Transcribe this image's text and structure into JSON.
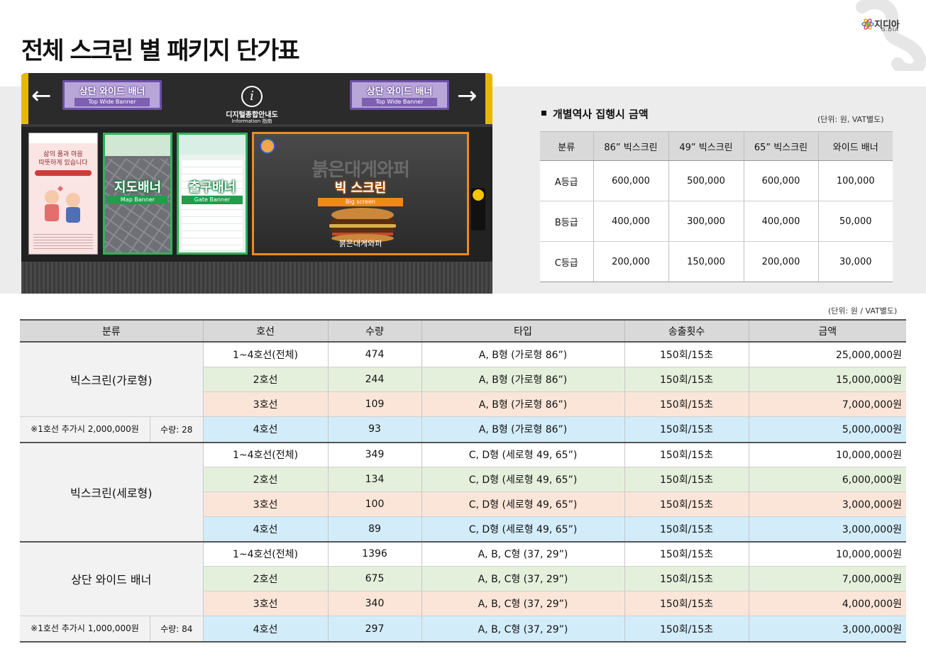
{
  "page": {
    "title": "전체 스크린 별 패키지 단가표",
    "logo": {
      "text": "지디아",
      "sub": "G.DIA"
    }
  },
  "kiosk": {
    "left_arrow": "←",
    "right_arrow": "→",
    "wide_banner_label": "상단 와이드 배너",
    "wide_banner_sub": "Top Wide Banner",
    "info_title": "디지털종합안내도",
    "info_sub": "Information 指南",
    "map_banner_label": "지도배너",
    "map_banner_sub": "Map Banner",
    "gate_banner_label": "출구배너",
    "gate_banner_sub": "Gate Banner",
    "big_headline": "붉은대게와퍼",
    "big_label": "빅 스크린",
    "big_sub": "Big screen",
    "big_footer": "붉은대게와퍼",
    "poster_text_1": "삶의 품과 마음",
    "poster_text_2": "따뜻하게 있습니다"
  },
  "small_table": {
    "title": "개별역사 집행시 금액",
    "unit": "(단위: 원, VAT별도)",
    "headers": [
      "분류",
      "86” 빅스크린",
      "49” 빅스크린",
      "65” 빅스크린",
      "와이드 배너"
    ],
    "rows": [
      [
        "A등급",
        "600,000",
        "500,000",
        "600,000",
        "100,000"
      ],
      [
        "B등급",
        "400,000",
        "300,000",
        "400,000",
        "50,000"
      ],
      [
        "C등급",
        "200,000",
        "150,000",
        "200,000",
        "30,000"
      ]
    ]
  },
  "main_table": {
    "unit": "(단위: 원 / VAT별도)",
    "headers": [
      "분류",
      "호선",
      "수량",
      "타입",
      "송출횟수",
      "금액"
    ],
    "groups": [
      {
        "category": "빅스크린(가로형)",
        "note": "※1호선 추가시 2,000,000원",
        "note_qty": "수량: 28",
        "rows": [
          [
            "1~4호선(전체)",
            "474",
            "A, B형 (가로형 86”)",
            "150회/15초",
            "25,000,000원"
          ],
          [
            "2호선",
            "244",
            "A, B형 (가로형 86”)",
            "150회/15초",
            "15,000,000원"
          ],
          [
            "3호선",
            "109",
            "A, B형 (가로형 86”)",
            "150회/15초",
            "7,000,000원"
          ],
          [
            "4호선",
            "93",
            "A, B형 (가로형 86”)",
            "150회/15초",
            "5,000,000원"
          ]
        ]
      },
      {
        "category": "빅스크린(세로형)",
        "note": "",
        "note_qty": "",
        "rows": [
          [
            "1~4호선(전체)",
            "349",
            "C, D형 (세로형 49, 65”)",
            "150회/15초",
            "10,000,000원"
          ],
          [
            "2호선",
            "134",
            "C, D형 (세로형 49, 65”)",
            "150회/15초",
            "6,000,000원"
          ],
          [
            "3호선",
            "100",
            "C, D형 (세로형 49, 65”)",
            "150회/15초",
            "3,000,000원"
          ],
          [
            "4호선",
            "89",
            "C, D형 (세로형 49, 65”)",
            "150회/15초",
            "3,000,000원"
          ]
        ]
      },
      {
        "category": "상단 와이드 배너",
        "note": "※1호선 추가시 1,000,000원",
        "note_qty": "수량: 84",
        "rows": [
          [
            "1~4호선(전체)",
            "1396",
            "A, B, C형 (37, 29”)",
            "150회/15초",
            "10,000,000원"
          ],
          [
            "2호선",
            "675",
            "A, B, C형 (37, 29”)",
            "150회/15초",
            "7,000,000원"
          ],
          [
            "3호선",
            "340",
            "A, B, C형 (37, 29”)",
            "150회/15초",
            "4,000,000원"
          ],
          [
            "4호선",
            "297",
            "A, B, C형 (37, 29”)",
            "150회/15초",
            "3,000,000원"
          ]
        ]
      }
    ]
  },
  "colors": {
    "row_white": "#ffffff",
    "row_green": "#e4f0dc",
    "row_peach": "#fbe5d8",
    "row_blue": "#d2ecfa",
    "accent_green": "#2fb35b",
    "accent_orange": "#ef8a1a",
    "accent_purple": "#6e4fa8"
  }
}
